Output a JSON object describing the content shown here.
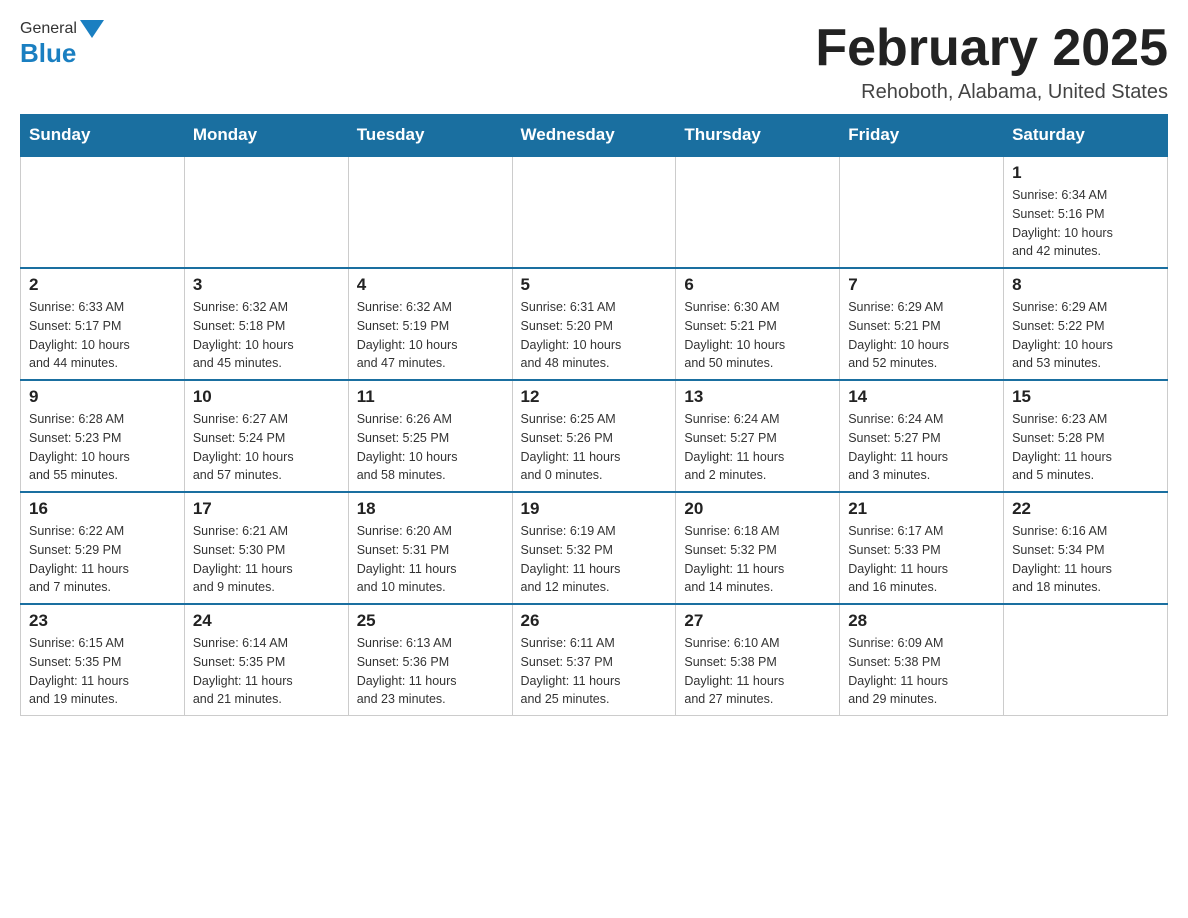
{
  "header": {
    "logo": {
      "part1": "General",
      "part2": "Blue"
    },
    "title": "February 2025",
    "location": "Rehoboth, Alabama, United States"
  },
  "weekdays": [
    "Sunday",
    "Monday",
    "Tuesday",
    "Wednesday",
    "Thursday",
    "Friday",
    "Saturday"
  ],
  "weeks": [
    [
      {
        "day": "",
        "info": ""
      },
      {
        "day": "",
        "info": ""
      },
      {
        "day": "",
        "info": ""
      },
      {
        "day": "",
        "info": ""
      },
      {
        "day": "",
        "info": ""
      },
      {
        "day": "",
        "info": ""
      },
      {
        "day": "1",
        "info": "Sunrise: 6:34 AM\nSunset: 5:16 PM\nDaylight: 10 hours\nand 42 minutes."
      }
    ],
    [
      {
        "day": "2",
        "info": "Sunrise: 6:33 AM\nSunset: 5:17 PM\nDaylight: 10 hours\nand 44 minutes."
      },
      {
        "day": "3",
        "info": "Sunrise: 6:32 AM\nSunset: 5:18 PM\nDaylight: 10 hours\nand 45 minutes."
      },
      {
        "day": "4",
        "info": "Sunrise: 6:32 AM\nSunset: 5:19 PM\nDaylight: 10 hours\nand 47 minutes."
      },
      {
        "day": "5",
        "info": "Sunrise: 6:31 AM\nSunset: 5:20 PM\nDaylight: 10 hours\nand 48 minutes."
      },
      {
        "day": "6",
        "info": "Sunrise: 6:30 AM\nSunset: 5:21 PM\nDaylight: 10 hours\nand 50 minutes."
      },
      {
        "day": "7",
        "info": "Sunrise: 6:29 AM\nSunset: 5:21 PM\nDaylight: 10 hours\nand 52 minutes."
      },
      {
        "day": "8",
        "info": "Sunrise: 6:29 AM\nSunset: 5:22 PM\nDaylight: 10 hours\nand 53 minutes."
      }
    ],
    [
      {
        "day": "9",
        "info": "Sunrise: 6:28 AM\nSunset: 5:23 PM\nDaylight: 10 hours\nand 55 minutes."
      },
      {
        "day": "10",
        "info": "Sunrise: 6:27 AM\nSunset: 5:24 PM\nDaylight: 10 hours\nand 57 minutes."
      },
      {
        "day": "11",
        "info": "Sunrise: 6:26 AM\nSunset: 5:25 PM\nDaylight: 10 hours\nand 58 minutes."
      },
      {
        "day": "12",
        "info": "Sunrise: 6:25 AM\nSunset: 5:26 PM\nDaylight: 11 hours\nand 0 minutes."
      },
      {
        "day": "13",
        "info": "Sunrise: 6:24 AM\nSunset: 5:27 PM\nDaylight: 11 hours\nand 2 minutes."
      },
      {
        "day": "14",
        "info": "Sunrise: 6:24 AM\nSunset: 5:27 PM\nDaylight: 11 hours\nand 3 minutes."
      },
      {
        "day": "15",
        "info": "Sunrise: 6:23 AM\nSunset: 5:28 PM\nDaylight: 11 hours\nand 5 minutes."
      }
    ],
    [
      {
        "day": "16",
        "info": "Sunrise: 6:22 AM\nSunset: 5:29 PM\nDaylight: 11 hours\nand 7 minutes."
      },
      {
        "day": "17",
        "info": "Sunrise: 6:21 AM\nSunset: 5:30 PM\nDaylight: 11 hours\nand 9 minutes."
      },
      {
        "day": "18",
        "info": "Sunrise: 6:20 AM\nSunset: 5:31 PM\nDaylight: 11 hours\nand 10 minutes."
      },
      {
        "day": "19",
        "info": "Sunrise: 6:19 AM\nSunset: 5:32 PM\nDaylight: 11 hours\nand 12 minutes."
      },
      {
        "day": "20",
        "info": "Sunrise: 6:18 AM\nSunset: 5:32 PM\nDaylight: 11 hours\nand 14 minutes."
      },
      {
        "day": "21",
        "info": "Sunrise: 6:17 AM\nSunset: 5:33 PM\nDaylight: 11 hours\nand 16 minutes."
      },
      {
        "day": "22",
        "info": "Sunrise: 6:16 AM\nSunset: 5:34 PM\nDaylight: 11 hours\nand 18 minutes."
      }
    ],
    [
      {
        "day": "23",
        "info": "Sunrise: 6:15 AM\nSunset: 5:35 PM\nDaylight: 11 hours\nand 19 minutes."
      },
      {
        "day": "24",
        "info": "Sunrise: 6:14 AM\nSunset: 5:35 PM\nDaylight: 11 hours\nand 21 minutes."
      },
      {
        "day": "25",
        "info": "Sunrise: 6:13 AM\nSunset: 5:36 PM\nDaylight: 11 hours\nand 23 minutes."
      },
      {
        "day": "26",
        "info": "Sunrise: 6:11 AM\nSunset: 5:37 PM\nDaylight: 11 hours\nand 25 minutes."
      },
      {
        "day": "27",
        "info": "Sunrise: 6:10 AM\nSunset: 5:38 PM\nDaylight: 11 hours\nand 27 minutes."
      },
      {
        "day": "28",
        "info": "Sunrise: 6:09 AM\nSunset: 5:38 PM\nDaylight: 11 hours\nand 29 minutes."
      },
      {
        "day": "",
        "info": ""
      }
    ]
  ]
}
